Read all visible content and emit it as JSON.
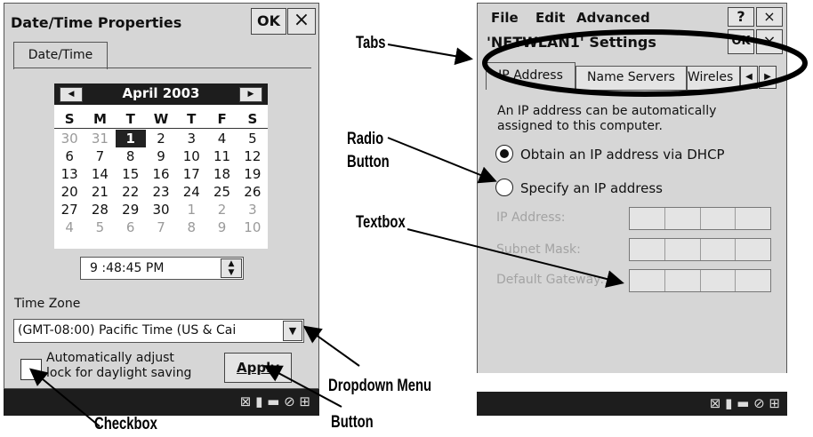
{
  "left": {
    "title": "Date/Time Properties",
    "ok": "OK",
    "close": "×",
    "tab": "Date/Time",
    "calendar": {
      "month": "April 2003",
      "prev": "◀",
      "next": "▶",
      "weekdays": [
        "S",
        "M",
        "T",
        "W",
        "T",
        "F",
        "S"
      ],
      "rows": [
        [
          "30",
          "31",
          "1",
          "2",
          "3",
          "4",
          "5"
        ],
        [
          "6",
          "7",
          "8",
          "9",
          "10",
          "11",
          "12"
        ],
        [
          "13",
          "14",
          "15",
          "16",
          "17",
          "18",
          "19"
        ],
        [
          "20",
          "21",
          "22",
          "23",
          "24",
          "25",
          "26"
        ],
        [
          "27",
          "28",
          "29",
          "30",
          "1",
          "2",
          "3"
        ],
        [
          "4",
          "5",
          "6",
          "7",
          "8",
          "9",
          "10"
        ]
      ]
    },
    "time": "9 :48:45 PM",
    "time_zone_label": "Time Zone",
    "time_zone_value": "(GMT-08:00) Pacific Time (US & Cai",
    "checkbox_label_1": "Automatically adjust",
    "checkbox_label_2": "lock for daylight saving",
    "apply": "Apply"
  },
  "right": {
    "menu": [
      "File",
      "Edit",
      "Advanced"
    ],
    "menu_help": "?",
    "menu_close": "×",
    "title": "'NETWLAN1' Settings",
    "ok": "OK",
    "close": "×",
    "tabs": [
      "IP Address",
      "Name Servers",
      "Wireles"
    ],
    "description": "An IP address can be automatically assigned to this computer.",
    "radio_dhcp": "Obtain an IP address via DHCP",
    "radio_specify": "Specify an IP address",
    "ip_label": "IP Address:",
    "subnet_label": "Subnet Mask:",
    "gateway_label": "Default Gateway:"
  },
  "annotations": {
    "tabs": "Tabs",
    "radio1": "Radio",
    "radio2": "Button",
    "textbox": "Textbox",
    "dropdown": "Dropdown Menu",
    "checkbox": "Checkbox",
    "button": "Button"
  }
}
